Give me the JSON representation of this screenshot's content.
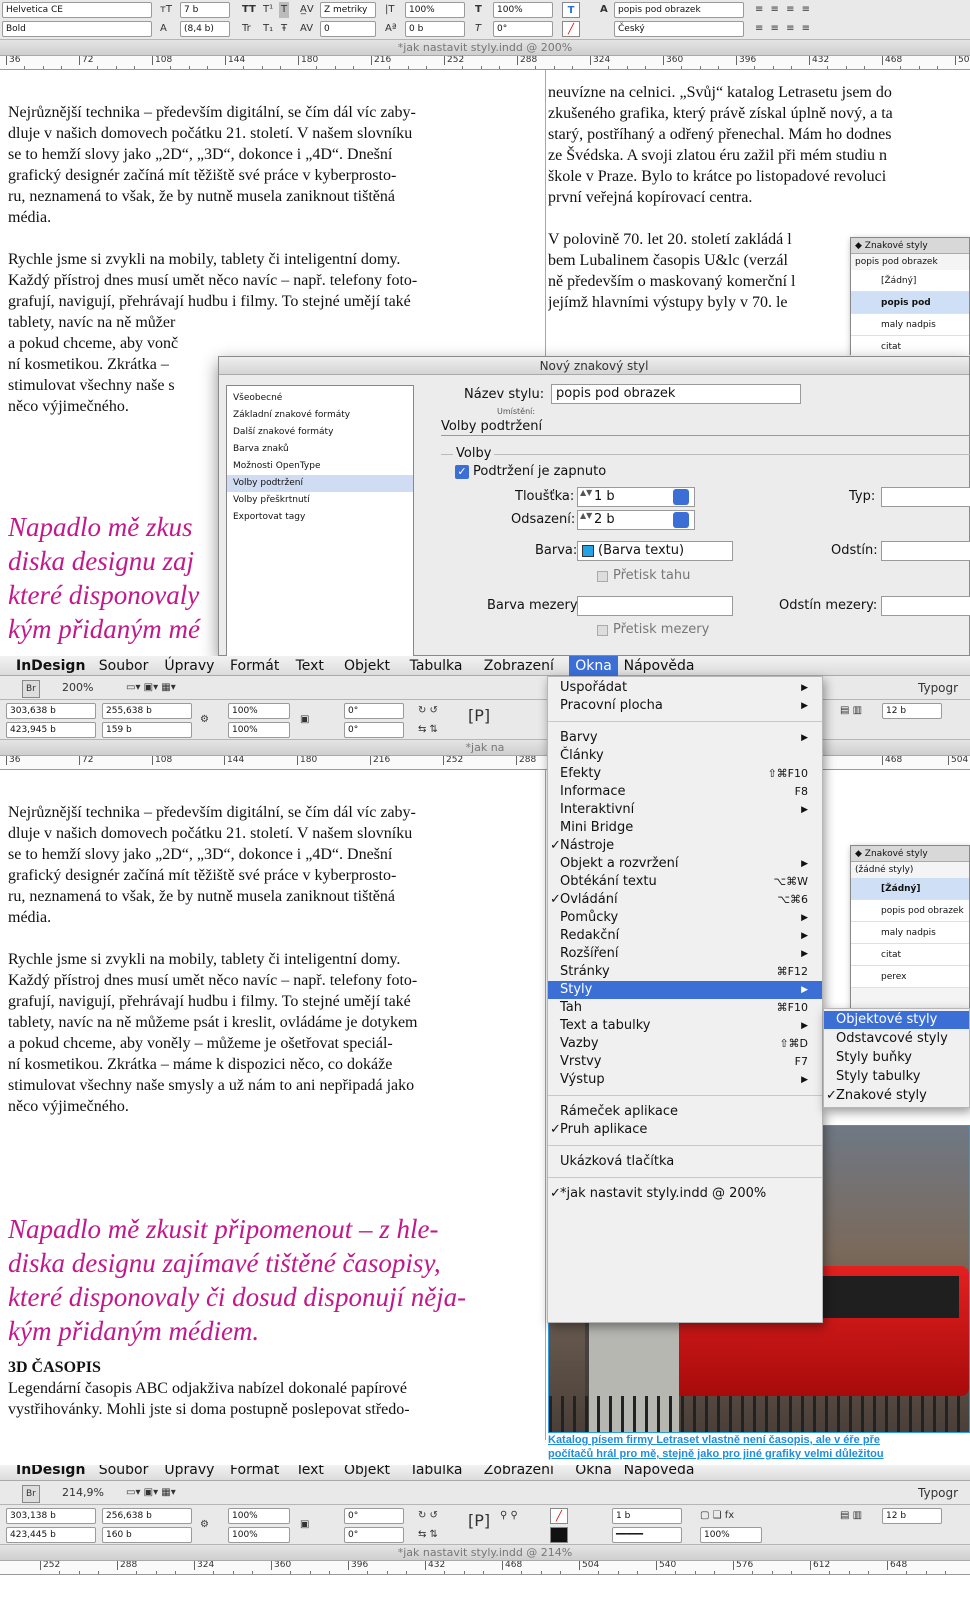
{
  "section1": {
    "control": {
      "font_family": "Helvetica CE",
      "font_style": "Bold",
      "size": "7 b",
      "leading": "(8,4 b)",
      "kerning": "Z metriky",
      "tracking": "0",
      "vscale": "100%",
      "hscale": "100%",
      "baseline": "0 b",
      "skew": "0°",
      "char_style": "popis pod obrazek",
      "language": "Český",
      "icons": [
        "TT",
        "T¹",
        "T",
        "Tr",
        "T₁",
        "Ŧ",
        "A"
      ]
    },
    "doc_title": "*jak nastavit styly.indd @ 200%",
    "ruler": [
      "36",
      "72",
      "108",
      "144",
      "180",
      "216",
      "252",
      "288",
      "324",
      "360",
      "396",
      "432",
      "468",
      "504"
    ],
    "left_text": [
      "Nejrůznější technika – především digitální, se čím dál víc zaby-",
      "dluje v našich domovech počátku 21. století. V našem slovníku",
      "se to hemží slovy jako „2D“, „3D“, dokonce i „4D“. Dnešní",
      "grafický designér začíná mít těžiště své práce v kyberprosto-",
      "ru, neznamená to však, že by nutně musela zaniknout tištěná",
      "média.",
      "",
      "Rychle jsme si zvykli na mobily, tablety či inteligentní domy.",
      "Každý přístroj dnes musí umět něco navíc – např. telefony foto-",
      "grafují, navigují, přehrávají hudbu i filmy. To stejné umějí také",
      "tablety, navíc na ně můžer",
      "a pokud chceme, aby vonč",
      "ní kosmetikou. Zkrátka –",
      "stimulovat všechny naše s",
      "něco výjimečného."
    ],
    "left_magenta": [
      "Napadlo mě zkus",
      "diska designu zaj",
      "které disponovaly",
      "kým přidaným mé"
    ],
    "right_text": [
      "neuvízne na celnici. „Svůj“ katalog Letrasetu jsem do",
      "zkušeného grafika, který právě získal úplně nový, a ta",
      "starý, postříhaný a odřený přenechal. Mám ho dodnes",
      "ze Švédska. A svoji zlatou éru zažil při mém studiu n",
      "škole v Praze. Bylo to krátce po listopadové revoluci",
      "první veřejná kopírovací centra.",
      "",
      "V polovině 70. let 20. století zakládá l",
      "bem Lubalinem  časopis U&lc (verzál",
      "ně především o maskovaný komerční l",
      "jejímž hlavními výstupy byly v 70. le"
    ],
    "panel": {
      "title": "Znakové styly",
      "current": "popis pod obrazek",
      "items": [
        "[Žádný]",
        "popis pod obrazek",
        "maly nadpis",
        "citat"
      ]
    },
    "dialog": {
      "title": "Nový znakový styl",
      "categories": [
        "Všeobecné",
        "Základní znakové formáty",
        "Další znakové formáty",
        "Barva znaků",
        "Možnosti OpenType",
        "Volby podtržení",
        "Volby přeškrtnutí",
        "Exportovat tagy"
      ],
      "selected_category": "Volby podtržení",
      "style_name_label": "Název stylu:",
      "style_name": "popis pod obrazek",
      "location_label": "Umístění:",
      "section_title": "Volby podtržení",
      "group_title": "Volby",
      "enable_label": "Podtržení je zapnuto",
      "weight_label": "Tloušťka:",
      "weight": "1 b",
      "offset_label": "Odsazení:",
      "offset": "2 b",
      "type_label": "Typ:",
      "color_label": "Barva:",
      "color_value": "(Barva textu)",
      "tint_label": "Odstín:",
      "overprint_stroke": "Přetisk tahu",
      "gap_color_label": "Barva mezery:",
      "gap_tint_label": "Odstín mezery:",
      "overprint_gap": "Přetisk mezery"
    }
  },
  "section2": {
    "menubar": [
      "InDesign",
      "Soubor",
      "Úpravy",
      "Formát",
      "Text",
      "Objekt",
      "Tabulka",
      "Zobrazení",
      "Okna",
      "Nápověda"
    ],
    "active_menu": "Okna",
    "zoom": "200%",
    "workspace": "Typogr",
    "control": {
      "x": "303,638 b",
      "y": "423,945 b",
      "w": "255,638 b",
      "h": "159 b",
      "sx": "100%",
      "sy": "100%",
      "rot": "0°",
      "shear": "0°",
      "stroke": "12 b"
    },
    "doc_title": "*jak na",
    "ruler": [
      "36",
      "72",
      "108",
      "144",
      "180",
      "216",
      "252",
      "288",
      "468",
      "504"
    ],
    "left_text": [
      "Nejrůznější technika – především digitální, se čím dál víc zaby-",
      "dluje v našich domovech počátku 21. století. V našem slovníku",
      "se to hemží slovy jako „2D“, „3D“, dokonce i „4D“. Dnešní",
      "grafický designér začíná mít těžiště své práce v kyberprosto-",
      "ru, neznamená to však, že by nutně musela zaniknout tištěná",
      "média.",
      "",
      "Rychle jsme si zvykli na mobily, tablety či inteligentní domy.",
      "Každý přístroj dnes musí umět něco navíc – např. telefony foto-",
      "grafují, navigují, přehrávají hudbu i filmy. To stejné umějí také",
      "tablety, navíc na ně můžeme psát i kreslit, ovládáme je dotykem",
      "a pokud chceme, aby voněly – můžeme je ošetřovat speciál-",
      "ní kosmetikou. Zkrátka – máme k dispozici něco, co dokáže",
      "stimulovat všechny naše smysly a už nám to ani nepřipadá jako",
      "něco výjimečného."
    ],
    "magenta": [
      "Napadlo mě zkusit připomenout – z hle-",
      "diska designu zajímavé tištěné časopisy,",
      "které disponovaly či dosud disponují něja-",
      "kým přidaným médiem."
    ],
    "heading": "3D ČASOPIS",
    "after_heading": [
      "Legendární časopis ABC odjakživa nabízel dokonalé papírové",
      "vystřihovánky. Mohli jste si doma postupně poslepovat středo-"
    ],
    "right_visible": [
      "g Letrasetu jsem do",
      "al.",
      "il pi",
      "stop"
    ],
    "right_initials": [
      "n",
      "z",
      "s",
      "z",
      "š",
      "p",
      "V",
      "H",
      "v",
      "I",
      "n"
    ],
    "menu": [
      {
        "label": "Uspořádat",
        "sub": true
      },
      {
        "label": "Pracovní plocha",
        "sub": true
      },
      {
        "sep": true
      },
      {
        "label": "Barvy",
        "sub": true
      },
      {
        "label": "Články"
      },
      {
        "label": "Efekty",
        "sc": "⇧⌘F10"
      },
      {
        "label": "Informace",
        "sc": "F8"
      },
      {
        "label": "Interaktivní",
        "sub": true
      },
      {
        "label": "Mini Bridge"
      },
      {
        "label": "Nástroje",
        "check": true
      },
      {
        "label": "Objekt a rozvržení",
        "sub": true
      },
      {
        "label": "Obtékání textu",
        "sc": "⌥⌘W"
      },
      {
        "label": "Ovládání",
        "check": true,
        "sc": "⌥⌘6"
      },
      {
        "label": "Pomůcky",
        "sub": true
      },
      {
        "label": "Redakční",
        "sub": true
      },
      {
        "label": "Rozšíření",
        "sub": true
      },
      {
        "label": "Stránky",
        "sc": "⌘F12"
      },
      {
        "label": "Styly",
        "sub": true,
        "sel": true
      },
      {
        "label": "Tah",
        "sc": "⌘F10"
      },
      {
        "label": "Text a tabulky",
        "sub": true
      },
      {
        "label": "Vazby",
        "sc": "⇧⌘D"
      },
      {
        "label": "Vrstvy",
        "sc": "F7"
      },
      {
        "label": "Výstup",
        "sub": true
      },
      {
        "sep": true
      },
      {
        "label": "Rámeček aplikace"
      },
      {
        "label": "Pruh aplikace",
        "check": true
      },
      {
        "sep": true
      },
      {
        "label": "Ukázková tlačítka"
      },
      {
        "sep": true
      },
      {
        "label": "*jak nastavit styly.indd @ 200%",
        "check": true
      }
    ],
    "submenu": [
      {
        "label": "Objektové styly",
        "sel": true
      },
      {
        "label": "Odstavcové styly"
      },
      {
        "label": "Styly buňky"
      },
      {
        "label": "Styly tabulky"
      },
      {
        "label": "Znakové styly",
        "check": true
      }
    ],
    "panel": {
      "title": "Znakové styly",
      "current": "(žádné styly)",
      "items": [
        "[Žádný]",
        "popis pod obrazek",
        "maly nadpis",
        "citat",
        "perex"
      ]
    },
    "caption": [
      "Katalog písem firmy Letraset vlastně není časopis, ale v éře pře",
      "počítačů hrál pro mě, stejně jako pro jiné grafiky velmi důležitou"
    ]
  },
  "section3": {
    "menubar": [
      "InDesign",
      "Soubor",
      "Úpravy",
      "Formát",
      "Text",
      "Objekt",
      "Tabulka",
      "Zobrazení",
      "Okna",
      "Nápověda"
    ],
    "zoom": "214,9%",
    "workspace": "Typogr",
    "control": {
      "x": "303,138 b",
      "y": "423,445 b",
      "w": "256,638 b",
      "h": "160 b",
      "sx": "100%",
      "sy": "100%",
      "rot": "0°",
      "shear": "0°",
      "stroke_w": "1 b",
      "opacity": "100%",
      "stroke": "12 b"
    },
    "doc_title": "*jak nastavit styly.indd @ 214%",
    "ruler": [
      "252",
      "288",
      "324",
      "360",
      "396",
      "432",
      "468",
      "504",
      "540",
      "576",
      "612",
      "648"
    ]
  },
  "colors": {
    "accent": "#3b6fd6",
    "magenta": "#c2188a",
    "caption": "#1f8ee0"
  }
}
